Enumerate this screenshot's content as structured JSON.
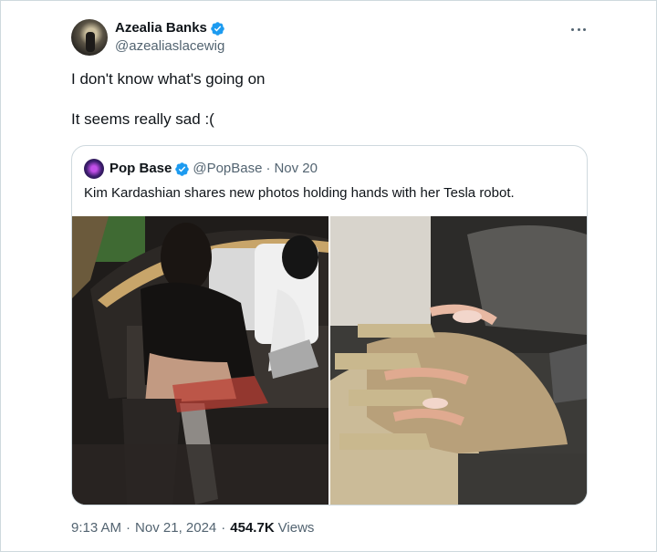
{
  "author": {
    "display_name": "Azealia Banks",
    "handle": "@azealiaslacewig",
    "verified": true
  },
  "tweet": {
    "line1": "I don't know what's going on",
    "line2": "It seems really sad :("
  },
  "quoted": {
    "display_name": "Pop Base",
    "handle": "@PopBase",
    "separator": "·",
    "date": "Nov 20",
    "text": "Kim Kardashian shares new photos holding hands with her Tesla robot.",
    "verified": true
  },
  "meta": {
    "time": "9:13 AM",
    "separator": "·",
    "date": "Nov 21, 2024",
    "views_count": "454.7K",
    "views_label": "Views"
  },
  "colors": {
    "verified_blue": "#1d9bf0",
    "secondary_text": "#536471",
    "border": "#cfd9de"
  },
  "icons": {
    "verified": "verified-badge-icon",
    "more": "more-options-icon"
  }
}
